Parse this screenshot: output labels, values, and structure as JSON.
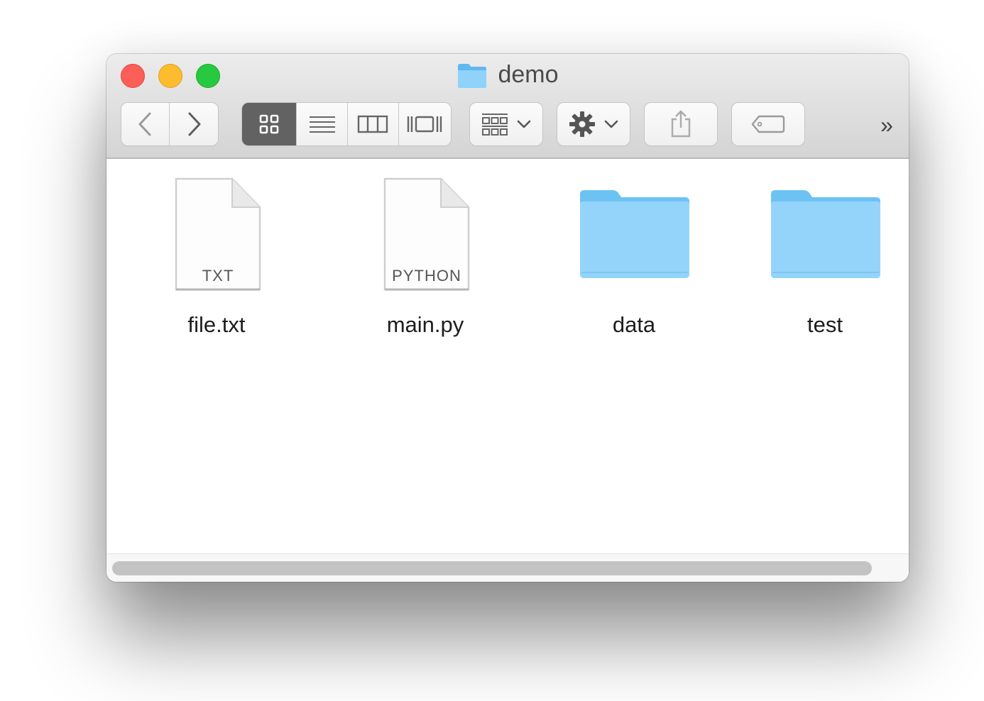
{
  "window": {
    "title": "demo",
    "title_icon": "folder-icon"
  },
  "toolbar": {
    "back_icon": "chevron-left-icon",
    "forward_icon": "chevron-right-icon",
    "view_modes": [
      "icon-view-icon",
      "list-view-icon",
      "column-view-icon",
      "cover-flow-icon"
    ],
    "active_view": "icon-view-icon",
    "arrange_icon": "arrange-grid-icon",
    "action_icon": "gear-icon",
    "share_icon": "share-icon",
    "tags_icon": "tag-icon",
    "overflow_label": "»"
  },
  "items": [
    {
      "name": "file.txt",
      "kind": "document",
      "badge": "TXT"
    },
    {
      "name": "main.py",
      "kind": "document",
      "badge": "PYTHON"
    },
    {
      "name": "data",
      "kind": "folder"
    },
    {
      "name": "test",
      "kind": "folder"
    }
  ],
  "colors": {
    "folder_light": "#9dd9fb",
    "folder_dark": "#5fb8ee",
    "close": "#fc5f57",
    "minimize": "#fdbc2e",
    "zoom": "#28c840"
  }
}
